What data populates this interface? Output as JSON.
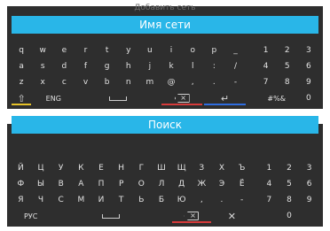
{
  "colors": {
    "panel_bg": "#2e2e2e",
    "title_bg": "#29b6e8",
    "yellow": "#e6c229",
    "green": "#3fae3f",
    "red": "#d63b3b",
    "blue": "#2f6de0"
  },
  "panel1": {
    "ghost_text": "Добавить сеть",
    "title": "Имя сети",
    "rows": [
      [
        "q",
        "w",
        "e",
        "r",
        "t",
        "y",
        "u",
        "i",
        "o",
        "p",
        "_"
      ],
      [
        "a",
        "s",
        "d",
        "f",
        "g",
        "h",
        "j",
        "k",
        "l",
        ":",
        "/"
      ],
      [
        "z",
        "x",
        "c",
        "v",
        "b",
        "n",
        "m",
        "@",
        ",",
        ".",
        "-"
      ]
    ],
    "digits": [
      [
        "1",
        "2",
        "3"
      ],
      [
        "4",
        "5",
        "6"
      ],
      [
        "7",
        "8",
        "9"
      ]
    ],
    "bottom": {
      "lang": "ENG",
      "symbols": "#%&",
      "zero": "0",
      "shift_icon": "shift-icon",
      "space_icon": "space-icon",
      "backspace_icon": "backspace-icon",
      "enter_icon": "enter-icon"
    }
  },
  "panel2": {
    "title": "Поиск",
    "rows": [
      [
        "Й",
        "Ц",
        "У",
        "К",
        "Е",
        "Н",
        "Г",
        "Ш",
        "Щ",
        "З",
        "Х",
        "Ъ"
      ],
      [
        "Ф",
        "Ы",
        "В",
        "А",
        "П",
        "Р",
        "О",
        "Л",
        "Д",
        "Ж",
        "Э",
        "Ё"
      ],
      [
        "Я",
        "Ч",
        "С",
        "М",
        "И",
        "Т",
        "Ь",
        "Б",
        "Ю",
        ",",
        ".",
        "-"
      ]
    ],
    "digits": [
      [
        "1",
        "2",
        "3"
      ],
      [
        "4",
        "5",
        "6"
      ],
      [
        "7",
        "8",
        "9"
      ]
    ],
    "bottom": {
      "lang": "РУС",
      "zero": "0",
      "space_icon": "space-icon",
      "backspace_icon": "backspace-icon",
      "close_icon": "close-icon"
    }
  }
}
